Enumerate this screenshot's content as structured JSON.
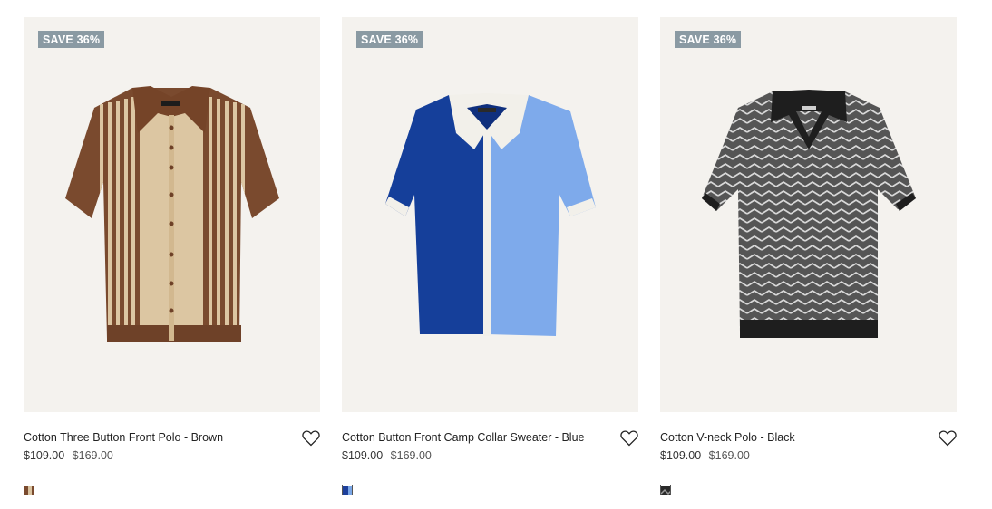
{
  "products": [
    {
      "badge": "SAVE 36%",
      "title": "Cotton Three Button Front Polo - Brown",
      "price": "$109.00",
      "original_price": "$169.00",
      "icon": "heart-icon",
      "swatch_colors": [
        "#7a4a2e",
        "#d9c3a0"
      ]
    },
    {
      "badge": "SAVE 36%",
      "title": "Cotton Button Front Camp Collar Sweater - Blue",
      "price": "$109.00",
      "original_price": "$169.00",
      "icon": "heart-icon",
      "swatch_colors": [
        "#1d3f9b",
        "#7aa6e6"
      ]
    },
    {
      "badge": "SAVE 36%",
      "title": "Cotton V-neck Polo - Black",
      "price": "$109.00",
      "original_price": "$169.00",
      "icon": "heart-icon",
      "swatch_colors": [
        "#2a2a2a",
        "#9a9a9a"
      ]
    }
  ],
  "colors": {
    "badge_bg": "#8a9aa3",
    "card_bg": "#f4f2ee"
  }
}
